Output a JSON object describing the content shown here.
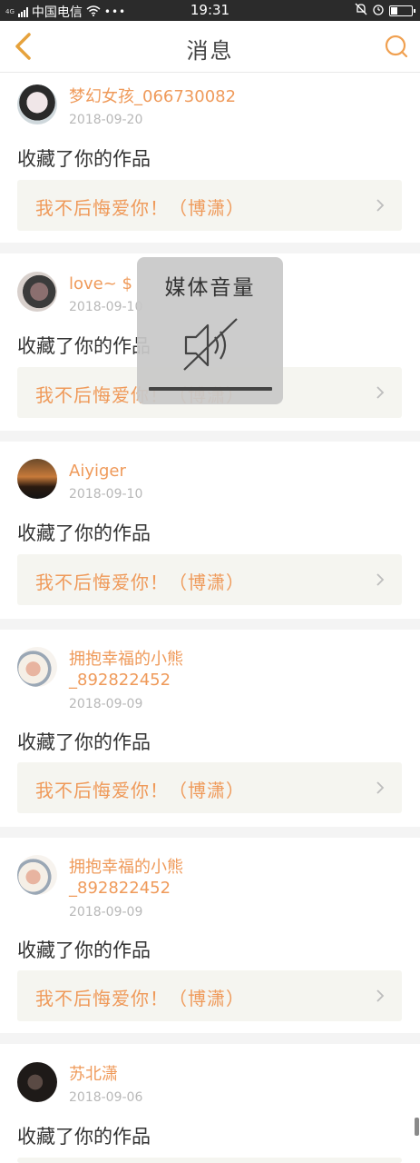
{
  "status_bar": {
    "network": "4G",
    "carrier": "中国电信",
    "wifi_icon": "wifi-icon",
    "more": "•••",
    "time": "19:31",
    "icons": [
      "mute-bell-icon",
      "alarm-icon",
      "battery-icon"
    ]
  },
  "header": {
    "title": "消息",
    "back_icon": "chevron-left-icon",
    "search_icon": "search-icon",
    "accent_color": "#f0a050"
  },
  "messages": [
    {
      "user": "梦幻女孩_066730082",
      "date": "2018-09-20",
      "action": "收藏了你的作品",
      "work": "我不后悔爱你！（博潇）"
    },
    {
      "user": "love~ $",
      "date": "2018-09-10",
      "action": "收藏了你的作品",
      "work": "我不后悔爱你！（博潇）"
    },
    {
      "user": "Aiyiger",
      "date": "2018-09-10",
      "action": "收藏了你的作品",
      "work": "我不后悔爱你！（博潇）"
    },
    {
      "user_line1": "拥抱幸福的小熊",
      "user_line2": "_892822452",
      "date": "2018-09-09",
      "action": "收藏了你的作品",
      "work": "我不后悔爱你！（博潇）"
    },
    {
      "user_line1": "拥抱幸福的小熊",
      "user_line2": "_892822452",
      "date": "2018-09-09",
      "action": "收藏了你的作品",
      "work": "我不后悔爱你！（博潇）"
    },
    {
      "user": "苏北潇",
      "date": "2018-09-06",
      "action": "收藏了你的作品"
    }
  ],
  "volume_popup": {
    "title": "媒体音量",
    "icon": "speaker-muted-icon",
    "level": 0
  },
  "colors": {
    "username": "#ef9a5a",
    "date": "#b8b8b8",
    "card_bg": "#f5f5f0",
    "divider": "#f4f4f4"
  }
}
